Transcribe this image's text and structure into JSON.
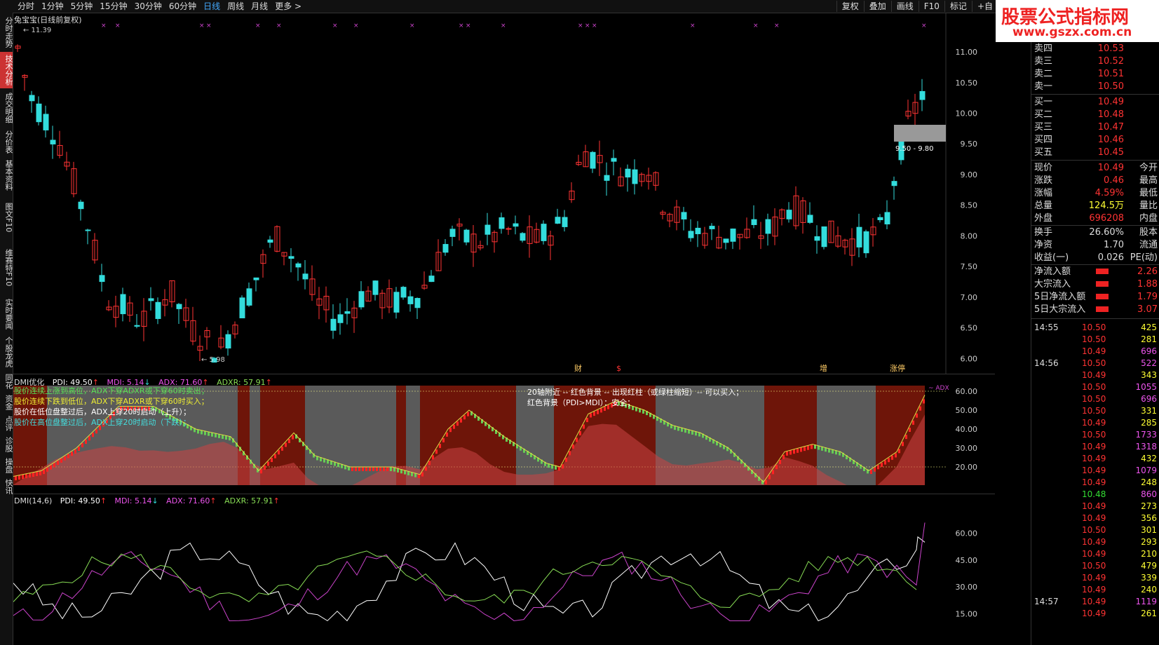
{
  "toolbar": {
    "periods": [
      "分时",
      "1分钟",
      "5分钟",
      "15分钟",
      "30分钟",
      "60分钟",
      "日线",
      "周线",
      "月线",
      "更多 >"
    ],
    "active_period": "日线",
    "tools": [
      "复权",
      "叠加",
      "画线",
      "F10",
      "标记",
      "+自"
    ]
  },
  "left_tabs": [
    "分时走势",
    "技术分析",
    "成交明细",
    "分价表",
    "基本资料",
    "图文F10",
    "维赛特F10",
    "实时要闻",
    "个股龙虎",
    "同花",
    "资金",
    "点评",
    "诊股",
    "操盘",
    "快讯"
  ],
  "active_left_tab": "技术分析",
  "logo": {
    "line1": "股票公式指标网",
    "line2": "www.gszx.com.cn"
  },
  "main_chart": {
    "title": "兔宝宝(日线前复权)",
    "high_label": "11.39",
    "low_label": "5.98",
    "price_range_label": "9.50 - 9.80",
    "y_ticks": [
      "11.00",
      "10.50",
      "10.00",
      "9.50",
      "9.00",
      "8.50",
      "8.00",
      "7.50",
      "7.00",
      "6.50",
      "6.00"
    ],
    "event_markers": [
      "财",
      "$",
      "增",
      "涨停"
    ]
  },
  "dmi_opt": {
    "title": "DMI优化",
    "pdi": "PDI: 49.50",
    "mdi": "MDI: 5.14",
    "adx": "ADX: 71.60",
    "adxr": "ADXR: 57.91",
    "legend": [
      "股价连续上涨到高位，ADX下穿ADXR或下穿60时卖出；",
      "股价连续下跌到低位，ADX下穿ADXR或下穿60时买入；",
      "股价在低位盘整过后，ADX上穿20时启动（上升）；",
      "股价在高位盘整过后，ADX上穿20时启动（下跌）；"
    ],
    "note1": "20轴附近 -- 红色背景 -- 出现红柱（或绿柱缩短）-- 可以买入；",
    "note2": "红色背景（PDI>MDI）：安全；",
    "y_ticks": [
      "60.00",
      "50.00",
      "40.00",
      "30.00",
      "20.00"
    ],
    "adx_tag": "ADX"
  },
  "dmi_chart": {
    "title": "DMI(14,6)",
    "pdi": "PDI: 49.50",
    "mdi": "MDI: 5.14",
    "adx": "ADX: 71.60",
    "adxr": "ADXR: 57.91",
    "y_ticks": [
      "60.00",
      "45.00",
      "30.00",
      "15.00"
    ]
  },
  "quote": {
    "asks": [
      {
        "label": "卖四",
        "price": "10.53"
      },
      {
        "label": "卖三",
        "price": "10.52"
      },
      {
        "label": "卖二",
        "price": "10.51"
      },
      {
        "label": "卖一",
        "price": "10.50"
      }
    ],
    "bids": [
      {
        "label": "买一",
        "price": "10.49"
      },
      {
        "label": "买二",
        "price": "10.48"
      },
      {
        "label": "买三",
        "price": "10.47"
      },
      {
        "label": "买四",
        "price": "10.46"
      },
      {
        "label": "买五",
        "price": "10.45"
      }
    ],
    "stats": [
      {
        "label": "现价",
        "value": "10.49",
        "right": "今开"
      },
      {
        "label": "涨跌",
        "value": "0.46",
        "right": "最高"
      },
      {
        "label": "涨幅",
        "value": "4.59%",
        "right": "最低"
      },
      {
        "label": "总量",
        "value": "124.5万",
        "right": "量比"
      },
      {
        "label": "外盘",
        "value": "696208",
        "right": "内盘"
      },
      {
        "label": "换手",
        "value": "26.60%",
        "right": "股本"
      },
      {
        "label": "净资",
        "value": "1.70",
        "right": "流通"
      },
      {
        "label": "收益(一)",
        "value": "0.026",
        "right": "PE(动)"
      }
    ],
    "flows": [
      {
        "label": "净流入额",
        "value": "2.26"
      },
      {
        "label": "大宗流入",
        "value": "1.88"
      },
      {
        "label": "5日净流入额",
        "value": "1.79"
      },
      {
        "label": "5日大宗流入",
        "value": "3.07"
      }
    ]
  },
  "ticks": [
    {
      "time": "14:55",
      "price": "10.50",
      "vol": "425"
    },
    {
      "time": "",
      "price": "10.50",
      "vol": "281"
    },
    {
      "time": "",
      "price": "10.49",
      "vol": "696"
    },
    {
      "time": "14:56",
      "price": "10.50",
      "vol": "522"
    },
    {
      "time": "",
      "price": "10.49",
      "vol": "343"
    },
    {
      "time": "",
      "price": "10.50",
      "vol": "1055"
    },
    {
      "time": "",
      "price": "10.50",
      "vol": "696"
    },
    {
      "time": "",
      "price": "10.50",
      "vol": "331"
    },
    {
      "time": "",
      "price": "10.49",
      "vol": "285"
    },
    {
      "time": "",
      "price": "10.50",
      "vol": "1733"
    },
    {
      "time": "",
      "price": "10.49",
      "vol": "1318"
    },
    {
      "time": "",
      "price": "10.49",
      "vol": "432"
    },
    {
      "time": "",
      "price": "10.49",
      "vol": "1079"
    },
    {
      "time": "",
      "price": "10.49",
      "vol": "248"
    },
    {
      "time": "",
      "price": "10.48",
      "vol": "860"
    },
    {
      "time": "",
      "price": "10.49",
      "vol": "273"
    },
    {
      "time": "",
      "price": "10.49",
      "vol": "356"
    },
    {
      "time": "",
      "price": "10.50",
      "vol": "301"
    },
    {
      "time": "",
      "price": "10.49",
      "vol": "293"
    },
    {
      "time": "",
      "price": "10.49",
      "vol": "210"
    },
    {
      "time": "",
      "price": "10.50",
      "vol": "479"
    },
    {
      "time": "",
      "price": "10.49",
      "vol": "339"
    },
    {
      "time": "",
      "price": "10.49",
      "vol": "240"
    },
    {
      "time": "14:57",
      "price": "10.49",
      "vol": "1119"
    },
    {
      "time": "",
      "price": "10.49",
      "vol": "261"
    }
  ],
  "colors": {
    "up": "#ff3333",
    "down": "#33dddd",
    "pdi": "#ffffff",
    "mdi": "#cc44cc",
    "adx": "#88dd55",
    "adxr": "#dddd44"
  }
}
